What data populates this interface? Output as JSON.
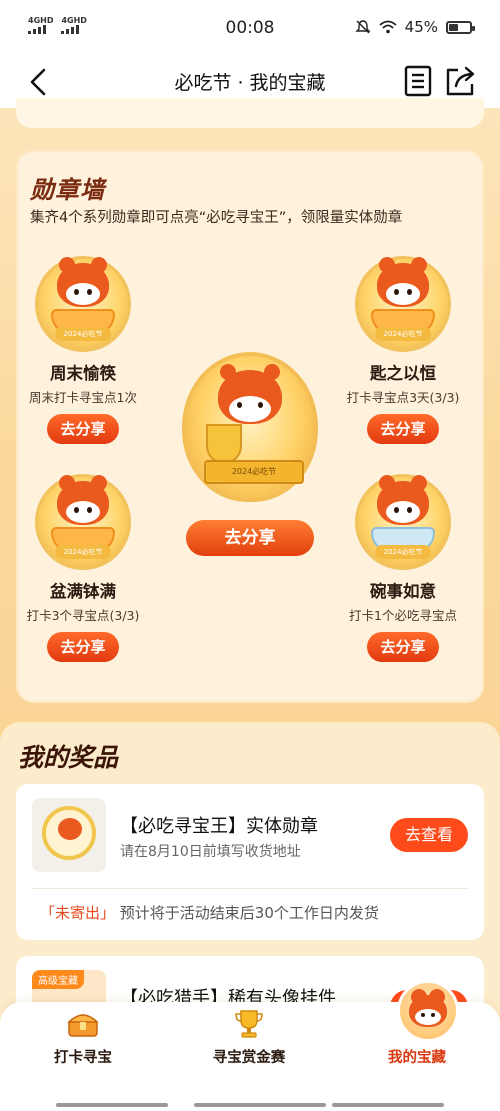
{
  "status": {
    "net1": "4GHD",
    "net2": "4GHD",
    "time": "00:08",
    "battery": "45%",
    "battery_level": 0.45
  },
  "nav": {
    "title": "必吃节 · 我的宝藏",
    "back_icon": "chevron-left-icon",
    "doc_icon": "document-icon",
    "share_icon": "share-icon"
  },
  "badge_wall": {
    "title": "勋章墙",
    "subtitle": "集齐4个系列勋章即可点亮“必吃寻宝王”，领限量实体勋章",
    "center": {
      "plate_text": "2024必吃节",
      "share_label": "去分享"
    },
    "items": [
      {
        "name": "周末愉筷",
        "desc": "周末打卡寻宝点1次",
        "ribbon": "2024必吃节",
        "share_label": "去分享"
      },
      {
        "name": "匙之以恒",
        "desc": "打卡寻宝点3天(3/3)",
        "ribbon": "2024必吃节",
        "share_label": "去分享"
      },
      {
        "name": "盆满钵满",
        "desc": "打卡3个寻宝点(3/3)",
        "ribbon": "2024必吃节",
        "share_label": "去分享"
      },
      {
        "name": "碗事如意",
        "desc": "打卡1个必吃寻宝点",
        "ribbon": "2024必吃节",
        "share_label": "去分享"
      }
    ]
  },
  "prizes": {
    "title": "我的奖品",
    "items": [
      {
        "name": "【必吃寻宝王】实体勋章",
        "sub": "请在8月10日前填写收货地址",
        "action": "去查看",
        "status_tag": "「未寄出」",
        "status_text": "预计将于活动结束后30个工作日内发货"
      },
      {
        "tag": "高级宝藏",
        "name": "【必吃猎手】稀有头像挂件"
      }
    ]
  },
  "tabs": [
    {
      "label": "打卡寻宝",
      "icon": "treasure-chest-icon"
    },
    {
      "label": "寻宝赏金赛",
      "icon": "trophy-icon"
    },
    {
      "label": "我的宝藏",
      "icon": "red-panda-icon",
      "active": true
    }
  ],
  "colors": {
    "accent": "#e84a1e",
    "button": "#ff4a1a",
    "background": "#fbd99e"
  }
}
